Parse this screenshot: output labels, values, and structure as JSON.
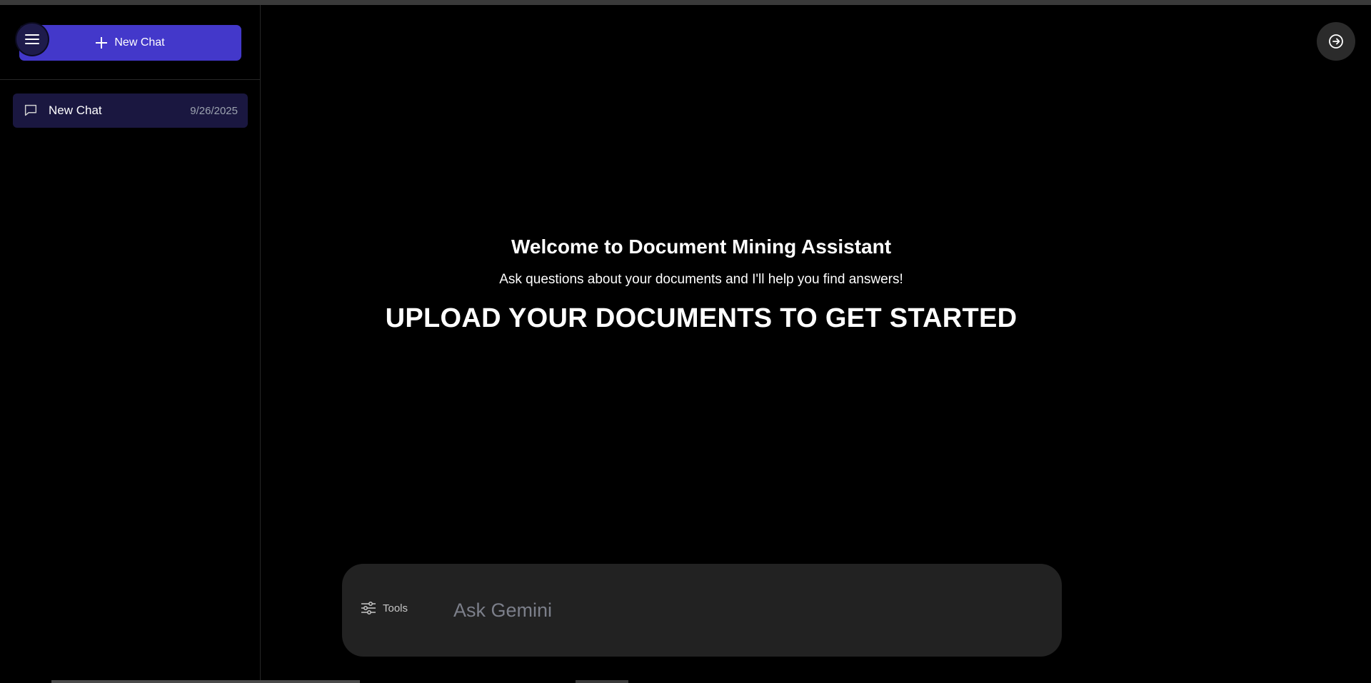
{
  "sidebar": {
    "new_chat_label": "New Chat",
    "chats": [
      {
        "title": "New Chat",
        "date": "9/26/2025"
      }
    ]
  },
  "main": {
    "welcome_title": "Welcome to Document Mining Assistant",
    "welcome_subtitle": "Ask questions about your documents and I'll help you find answers!",
    "upload_prompt": "UPLOAD YOUR DOCUMENTS TO GET STARTED"
  },
  "input_bar": {
    "tools_label": "Tools",
    "placeholder": "Ask Gemini"
  },
  "icons": {
    "menu": "hamburger-menu-icon",
    "plus": "plus-icon",
    "chat": "chat-bubble-icon",
    "logout": "arrow-circle-right-icon",
    "tools": "sliders-icon"
  },
  "colors": {
    "accent": "#4338ca",
    "active_chat": "#1a1740",
    "input_bg": "#222222"
  }
}
